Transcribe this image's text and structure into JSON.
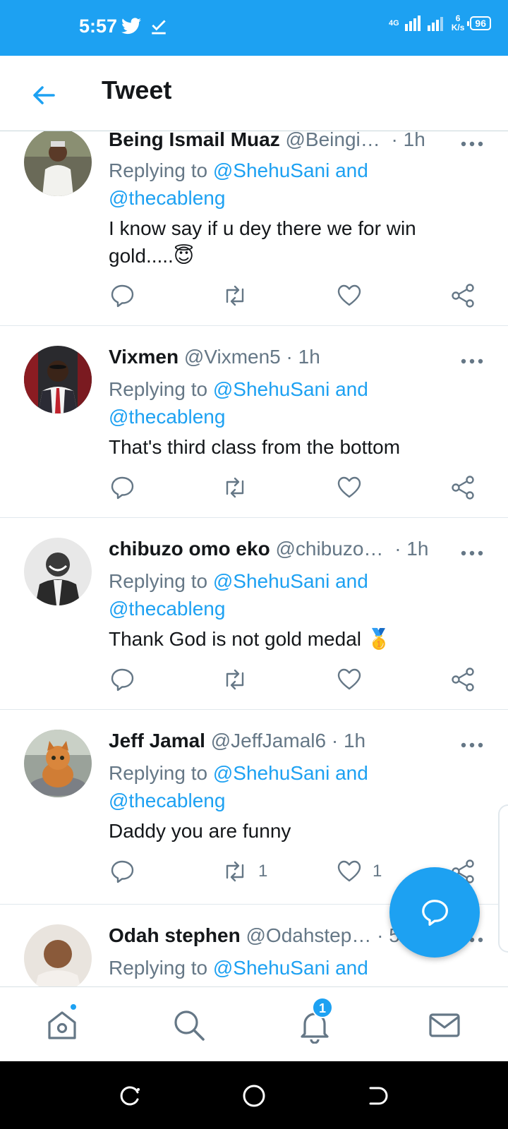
{
  "status_bar": {
    "time": "5:57",
    "network": "4G",
    "speed_value": "6",
    "speed_unit": "K/s",
    "battery": "96"
  },
  "header": {
    "title": "Tweet"
  },
  "tweets": [
    {
      "name": "Being Ismail Muaz",
      "handle": "@Beingi…",
      "time": "· 1h",
      "reply_prefix": "Replying to",
      "reply_to_1": "@ShehuSani and",
      "reply_to_2": "@thecableng",
      "text": "I know say if u dey there we for win gold.....",
      "emoji": "😇",
      "retweets": "",
      "likes": ""
    },
    {
      "name": "Vixmen",
      "handle": "@Vixmen5",
      "time": "· 1h",
      "reply_prefix": "Replying to",
      "reply_to_1": "@ShehuSani and",
      "reply_to_2": "@thecableng",
      "text": "That's third class from the bottom",
      "emoji": "",
      "retweets": "",
      "likes": ""
    },
    {
      "name": "chibuzo omo eko",
      "handle": "@chibuzo…",
      "time": "· 1h",
      "reply_prefix": "Replying to",
      "reply_to_1": "@ShehuSani and",
      "reply_to_2": "@thecableng",
      "text": "Thank God is not gold medal",
      "emoji": "🥇",
      "retweets": "",
      "likes": ""
    },
    {
      "name": "Jeff Jamal",
      "handle": "@JeffJamal6",
      "time": "· 1h",
      "reply_prefix": "Replying to",
      "reply_to_1": "@ShehuSani and",
      "reply_to_2": "@thecableng",
      "text": "Daddy you are funny",
      "emoji": "",
      "retweets": "1",
      "likes": "1"
    },
    {
      "name": "Odah stephen",
      "handle": "@Odahstep…",
      "time": "· 54m",
      "reply_prefix": "Replying to",
      "reply_to_1": "@ShehuSani and",
      "reply_to_2": "",
      "text": "",
      "emoji": "",
      "retweets": "",
      "likes": ""
    }
  ],
  "bottom_nav": {
    "notifications_count": "1"
  },
  "colors": {
    "accent": "#1da1f2",
    "text": "#14171a",
    "secondary": "#657786"
  },
  "icons": [
    "back-arrow-icon",
    "more-icon",
    "reply-icon",
    "retweet-icon",
    "like-icon",
    "share-icon",
    "compose-reply-icon",
    "home-icon",
    "search-icon",
    "notifications-icon",
    "messages-icon"
  ]
}
